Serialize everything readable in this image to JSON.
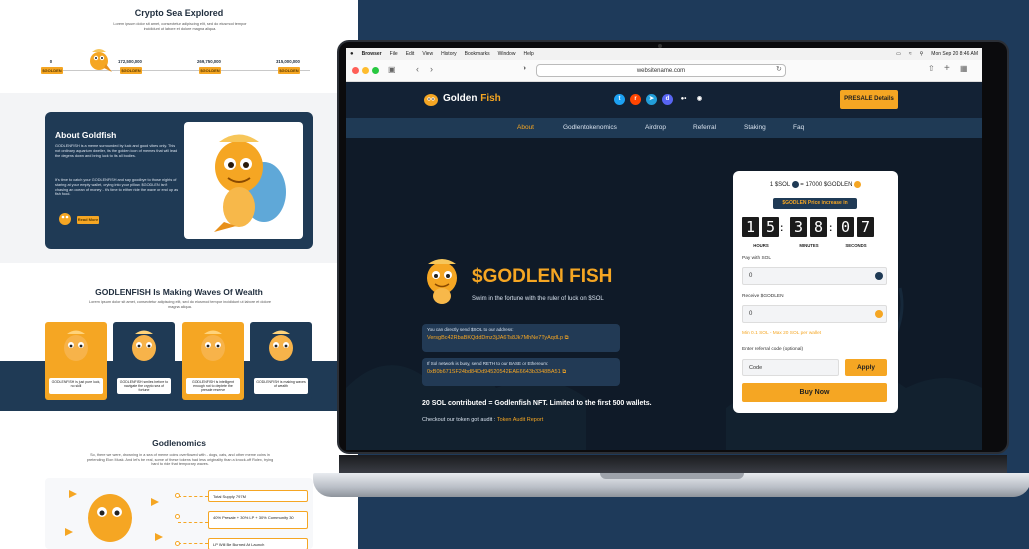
{
  "left": {
    "explored": {
      "title": "Crypto Sea Explored",
      "desc": "Lorem ipsum dolor sit amet, consectetur adipiscing elit, sed do eiusmod tempor incididunt ut labore et dolore magna aliqua.",
      "milestones": [
        {
          "value": "0",
          "badge": "$GOLDEN"
        },
        {
          "value": "172,500,000",
          "badge": "$GOLDEN"
        },
        {
          "value": "269,750,000",
          "badge": "$GOLDEN"
        },
        {
          "value": "315,000,000",
          "badge": "$GOLDEN"
        }
      ]
    },
    "about": {
      "title": "About Goldfish",
      "p1": "GODLENFISH is a meme surrounded by luck and good vibes only. This not ordinary aquarium dweller, its the golden icon of memes that will lead the degens down and bring luck to its all bodies.",
      "p2": "It's time to catch your GODLENFISH and say goodbye to those nights of staring at your empty wallet, crying into your pillow. $GODLEN isn't chasing an ocean of money - it's time to either ride the wave or end up as fish food.",
      "button": "Read More"
    },
    "waves": {
      "title": "GODLENFISH Is Making Waves Of Wealth",
      "desc": "Lorem ipsum dolor sit amet, consectetur adipiscing elit, sed do eiusmod tempor incididunt ut labore et dolore magna aliqua.",
      "cards": [
        "GODLENFISH is just pure luck, no skill",
        "GODLENFISH smiles before to navigate the crypto sea of fortune",
        "GODLENFISH is intelligent enough not to deplete the presale reserve",
        "GODLENFISH is making waves of wealth"
      ]
    },
    "tokenomics": {
      "title": "Godlenomics",
      "desc": "So, there we were, drowning in a sea of meme coins overflowed with - dogs, cats, and other meme coins in pretending Elon Musk. And let's be real, some of these tokens had less originality than a knock-off Rolex, trying hard to ride that temporary waves.",
      "items": [
        "Total Supply 797M",
        "40% Presale + 30% LP + 30% Community 30",
        "LP Will Be Burned At Launch"
      ]
    }
  },
  "macbar": {
    "apple": "",
    "items": [
      "Browser",
      "File",
      "Edit",
      "View",
      "History",
      "Bookmarks",
      "Window",
      "Help"
    ],
    "datetime": "Mon Sep 20  8:46 AM"
  },
  "browser": {
    "url": "websitename.com"
  },
  "site": {
    "brand_a": "Golden",
    "brand_b": "Fish",
    "presale_button": "PRESALE Details",
    "nav": [
      "About",
      "Godlentokenomics",
      "Airdrop",
      "Referral",
      "Staking",
      "Faq"
    ],
    "hero_title": "$GODLEN FISH",
    "hero_sub": "Swim in the fortune with the ruler of luck on $SOL",
    "addr1_label": "You can directly send $SOL to our address:",
    "addr1": "VersgBc42RbaBKQddDmz3jJA6Ts8Jk7MhNe7TyAqdLp",
    "addr2_label": "If Sol network is busy, send RETH to our BASE or Ethereum:",
    "addr2": "0xB0b671SF24bd84Dd94520542EAE6643b3348BA51",
    "contrib": "20 SOL contributed = Godlenfish NFT. Limited to the first 500 wallets.",
    "audit_prefix": "Checkout our token got audit : ",
    "audit_link": "Token Audit Report"
  },
  "presale": {
    "rate_left": "1 $SOL",
    "rate_eq": "=",
    "rate_right": "17000 $GODLEN",
    "increase_label": "$GODLEN Price increase in",
    "hours": "15",
    "minutes": "38",
    "seconds": "07",
    "hours_label": "HOURS",
    "minutes_label": "MINUTES",
    "seconds_label": "SECONDS",
    "pay_label": "Pay with SOL",
    "pay_value": "0",
    "receive_label": "Receive $GODLEN",
    "receive_value": "0",
    "limits": "Min 0.1 SOL - Max 20 SOL per wallet",
    "ref_label": "Enter referral code (optional)",
    "ref_placeholder": "Code",
    "apply": "Apply",
    "buy": "Buy Now"
  },
  "colors": {
    "accent": "#f5a623",
    "navy": "#1f3a55",
    "bg": "#1e3a5a"
  }
}
